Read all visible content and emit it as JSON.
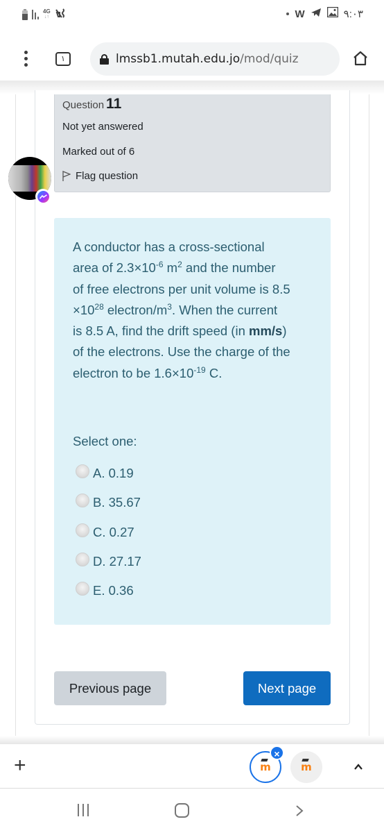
{
  "status_bar": {
    "left_icons": [
      "battery-icon",
      "signal-icon",
      "network-4g-icon",
      "vibrate-mute-icon"
    ],
    "network_label": "4G",
    "network_sub": "↓↑",
    "right_icons": [
      "notification-dot-icon",
      "word-app-icon",
      "telegram-icon",
      "gallery-icon"
    ],
    "word_glyph": "W",
    "time": "٩:٠٣"
  },
  "browser": {
    "menu_icon": "kebab-menu-icon",
    "tab_count": "١",
    "url_host": "lmssb1.mutah.edu.jo",
    "url_path": "/mod/quiz",
    "home_icon": "home-icon"
  },
  "question_info": {
    "label": "Question",
    "number": "11",
    "status": "Not yet answered",
    "marks": "Marked out of 6",
    "flag_label": "Flag question"
  },
  "question": {
    "line1": "A conductor has a cross-sectional",
    "area_prefix": "area of  2.3",
    "times": "×",
    "ten": "10",
    "area_exp": "-6",
    "area_unit": " m",
    "area_unit_exp": "2",
    "line2_rest": " and the number",
    "line3": "of free electrons per unit volume is 8.5",
    "n_exp": "28",
    "n_unit": " electron/m",
    "n_unit_exp": "3",
    "line4_rest": ". When the current",
    "line5_prefix": "is 8.5 A, find the drift speed (in ",
    "line5_bold": "mm/s",
    "line5_suffix": ")",
    "line6": "of the electrons. Use the charge of the",
    "line7_prefix": "electron to be 1.6",
    "charge_exp": "-19",
    "line7_suffix": " C."
  },
  "answer": {
    "prompt": "Select one:",
    "options": [
      {
        "label": "A. 0.19",
        "selected": false
      },
      {
        "label": "B. 35.67",
        "selected": false
      },
      {
        "label": "C. 0.27",
        "selected": false
      },
      {
        "label": "D. 27.17",
        "selected": false
      },
      {
        "label": "E. 0.36",
        "selected": false
      }
    ]
  },
  "navigation": {
    "previous_label": "Previous page",
    "next_label": "Next page"
  },
  "tab_strip": {
    "new_tab": "+",
    "close_glyph": "×",
    "tab_icon_letter": "m",
    "tabs": [
      {
        "name": "moodle-tab-active",
        "active": true
      },
      {
        "name": "moodle-tab-inactive",
        "active": false
      }
    ]
  },
  "colors": {
    "accent": "#0f6cbf",
    "info_bg": "#dee2e6",
    "question_bg": "#def2f8",
    "question_text": "#2c5e70",
    "chrome_blue": "#1a73e8",
    "moodle_orange": "#f98012"
  }
}
